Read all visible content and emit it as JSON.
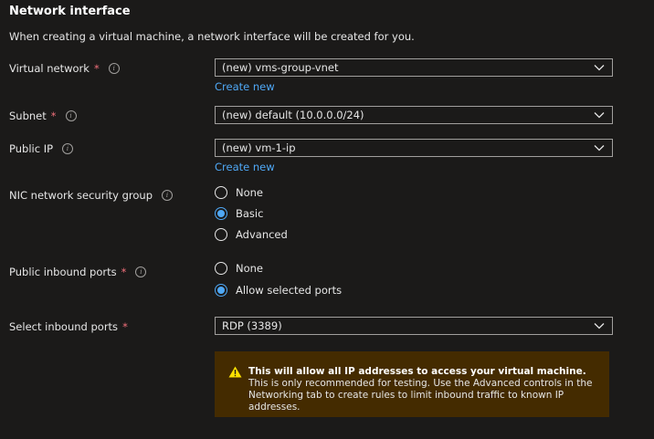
{
  "section": {
    "title": "Network interface",
    "description": "When creating a virtual machine, a network interface will be created for you."
  },
  "fields": {
    "virtual_network": {
      "label": "Virtual network",
      "required_mark": "*",
      "value": "(new) vms-group-vnet",
      "create_link": "Create new"
    },
    "subnet": {
      "label": "Subnet",
      "required_mark": "*",
      "value": "(new) default (10.0.0.0/24)"
    },
    "public_ip": {
      "label": "Public IP",
      "value": "(new) vm-1-ip",
      "create_link": "Create new"
    },
    "nic_nsg": {
      "label": "NIC network security group",
      "options": [
        "None",
        "Basic",
        "Advanced"
      ],
      "selected": "Basic"
    },
    "public_inbound_ports": {
      "label": "Public inbound ports",
      "required_mark": "*",
      "options": [
        "None",
        "Allow selected ports"
      ],
      "selected": "Allow selected ports"
    },
    "select_inbound_ports": {
      "label": "Select inbound ports",
      "required_mark": "*",
      "value": "RDP (3389)"
    }
  },
  "warning": {
    "bold_text": "This will allow all IP addresses to access your virtual machine.",
    "text": " This is only recommended for testing.  Use the Advanced controls in the Networking tab to create rules to limit inbound traffic to known IP addresses.",
    "icon": "warning-icon"
  },
  "colors": {
    "background": "#1b1a19",
    "accent": "#4fa8f5",
    "required": "#f1707b",
    "warning_bg": "#442b00",
    "warning_icon": "#fce100"
  }
}
